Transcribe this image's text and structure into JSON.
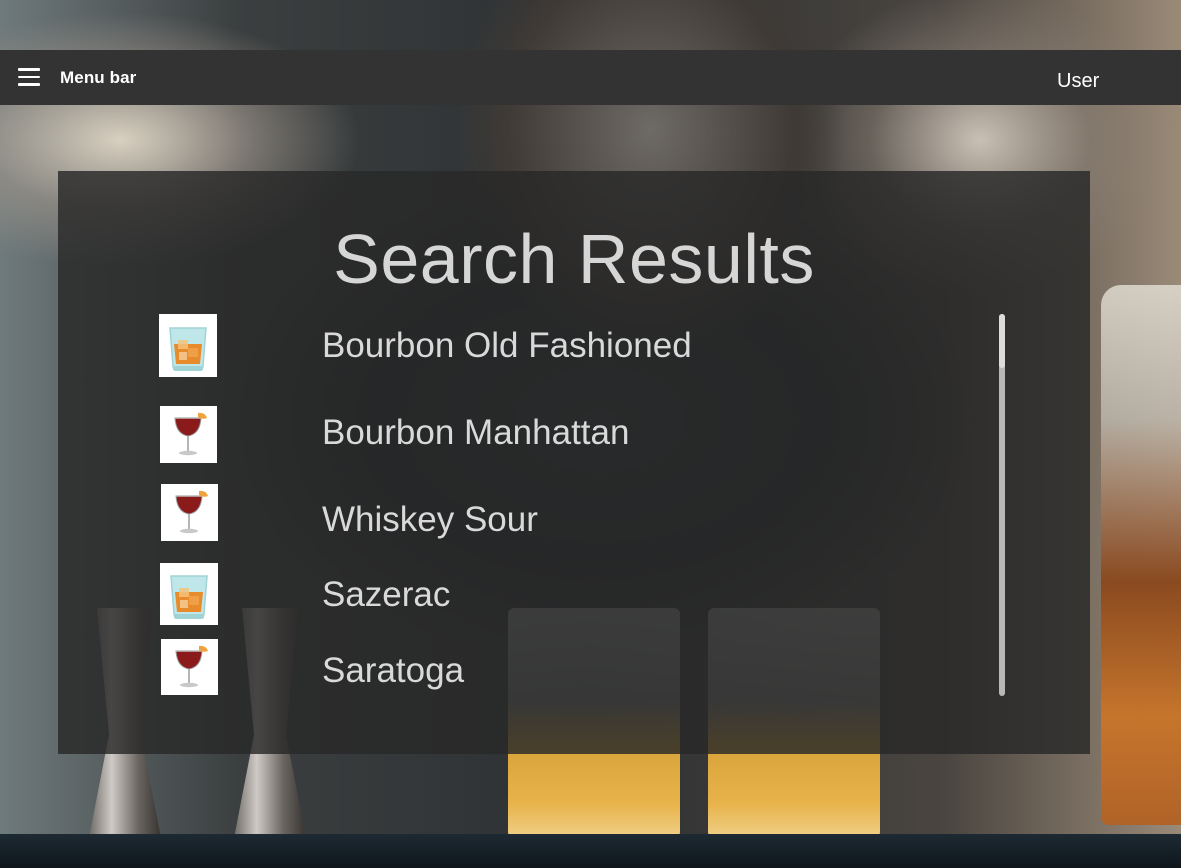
{
  "header": {
    "menu_label": "Menu bar",
    "user_label": "User"
  },
  "results": {
    "title": "Search Results",
    "items": [
      {
        "name": "Bourbon Old Fashioned",
        "icon": "rocks-glass-icon"
      },
      {
        "name": "Bourbon Manhattan",
        "icon": "coupe-glass-icon"
      },
      {
        "name": "Whiskey Sour",
        "icon": "coupe-glass-icon"
      },
      {
        "name": "Sazerac",
        "icon": "rocks-glass-icon"
      },
      {
        "name": "Saratoga",
        "icon": "coupe-glass-icon"
      }
    ]
  },
  "colors": {
    "topbar": "#333333",
    "panel": "rgba(40,40,40,0.82)",
    "text": "#d9d9d9"
  }
}
